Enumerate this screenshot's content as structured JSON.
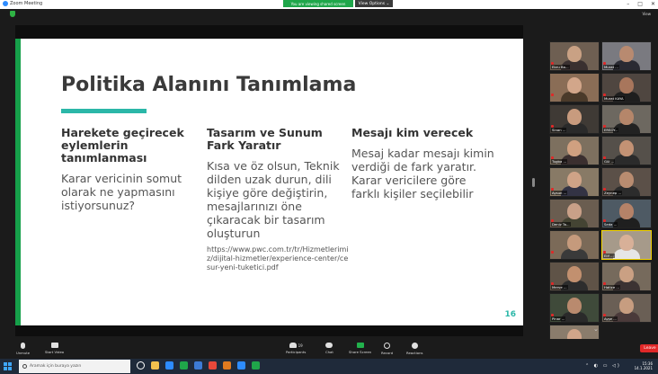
{
  "window": {
    "title": "Zoom Meeting",
    "share_banner": "You are viewing shared screen",
    "view_options": "View Options ⌄",
    "controls": [
      "–",
      "□",
      "✕"
    ],
    "view_button": "View"
  },
  "slide": {
    "title": "Politika Alanını Tanımlama",
    "page_number": "16",
    "columns": [
      {
        "heading": "Harekete geçirecek eylemlerin tanımlanması",
        "body": "Karar vericinin somut olarak ne yapmasını istiyorsunuz?"
      },
      {
        "heading": "Tasarım ve Sunum Fark Yaratır",
        "body": "Kısa ve öz olsun, Teknik dilden uzak durun, dili kişiye göre değiştirin, mesajlarınızı öne çıkaracak bir tasarım oluşturun",
        "url": "https://www.pwc.com.tr/tr/Hizmetlerimiz/dijital-hizmetler/experience-center/cesur-yeni-tuketici.pdf"
      },
      {
        "heading": "Mesajı kim verecek",
        "body": "Mesaj kadar mesajı kimin verdiği de fark yaratır. Karar vericilere göre farklı kişiler seçilebilir"
      }
    ]
  },
  "participants": [
    {
      "name": "Ebru Ba...",
      "face": "#c9a184",
      "bg": "#6e5f52",
      "body": "#3a3030"
    },
    {
      "name": "Murat ...",
      "face": "#b88a70",
      "bg": "#7a7a80",
      "body": "#2a2a33"
    },
    {
      "name": "",
      "face": "#d2a68a",
      "bg": "#8a6d56",
      "body": "#4a3a2a"
    },
    {
      "name": "Murat KAYA",
      "face": "#a8765c",
      "bg": "#4f4640",
      "body": "#1e1e1e"
    },
    {
      "name": "Sinan ...",
      "face": "#c89b7e",
      "bg": "#3f3a35",
      "body": "#2a2a2a"
    },
    {
      "name": "ERSOY...",
      "face": "#b5866a",
      "bg": "#6d6860",
      "body": "#222"
    },
    {
      "name": "Tugba ...",
      "face": "#d0a080",
      "bg": "#7d705f",
      "body": "#3b2f2f"
    },
    {
      "name": "Gül ...",
      "face": "#c39274",
      "bg": "#55504a",
      "body": "#2b2b2b"
    },
    {
      "name": "Aysun ...",
      "face": "#cfa387",
      "bg": "#887a66",
      "body": "#334"
    },
    {
      "name": "Zeynep ...",
      "face": "#b98c70",
      "bg": "#5b5048",
      "body": "#2c2c2c"
    },
    {
      "name": "Deniz Ta...",
      "face": "#c9a088",
      "bg": "#6a5d50",
      "body": "#443"
    },
    {
      "name": "Seda ...",
      "face": "#b58268",
      "bg": "#4e5a64",
      "body": "#1f1f1f"
    },
    {
      "name": "",
      "face": "#c59a7c",
      "bg": "#7b6a58",
      "body": "#3a3a3a"
    },
    {
      "name": "Elif ...",
      "face": "#d8b098",
      "bg": "#a69a8a",
      "body": "#e6e6e6"
    },
    {
      "name": "Merve ...",
      "face": "#c2906f",
      "bg": "#5f5347",
      "body": "#2d2d2d"
    },
    {
      "name": "Hatice ...",
      "face": "#caa083",
      "bg": "#766a5c",
      "body": "#3c3232"
    },
    {
      "name": "Pinar ...",
      "face": "#b98a6e",
      "bg": "#3f4a3a",
      "body": "#2a2a2a"
    },
    {
      "name": "Ayşe ...",
      "face": "#c79d80",
      "bg": "#6a5f55",
      "body": "#4a3a3a"
    },
    {
      "name": "Sibel ...",
      "face": "#d0a58a",
      "bg": "#8a7c6c",
      "body": "#333"
    }
  ],
  "toolbar": {
    "items": [
      {
        "label": "Unmute",
        "color": "#e0e0e0"
      },
      {
        "label": "Start Video",
        "color": "#e0e0e0"
      },
      {
        "label": "Participants",
        "color": "#e0e0e0",
        "count": "19"
      },
      {
        "label": "Chat",
        "color": "#e0e0e0"
      },
      {
        "label": "Share Screen",
        "color": "#22b14c"
      },
      {
        "label": "Record",
        "color": "#e0e0e0"
      },
      {
        "label": "Reactions",
        "color": "#e0e0e0"
      }
    ],
    "leave": "Leave"
  },
  "taskbar": {
    "search_placeholder": "Aramak için buraya yazın",
    "app_colors": [
      "#ffffff",
      "#f2c14e",
      "#2d8cff",
      "#1fa64a",
      "#3d7bd6",
      "#e8483a",
      "#e07a1f",
      "#2d8cff",
      "#1fa64a"
    ],
    "time": "15:36",
    "date": "14.1.2021"
  },
  "colors": {
    "slide_accent": "#2bb7a8",
    "slide_green": "#16a04a",
    "leave_red": "#e02828"
  }
}
